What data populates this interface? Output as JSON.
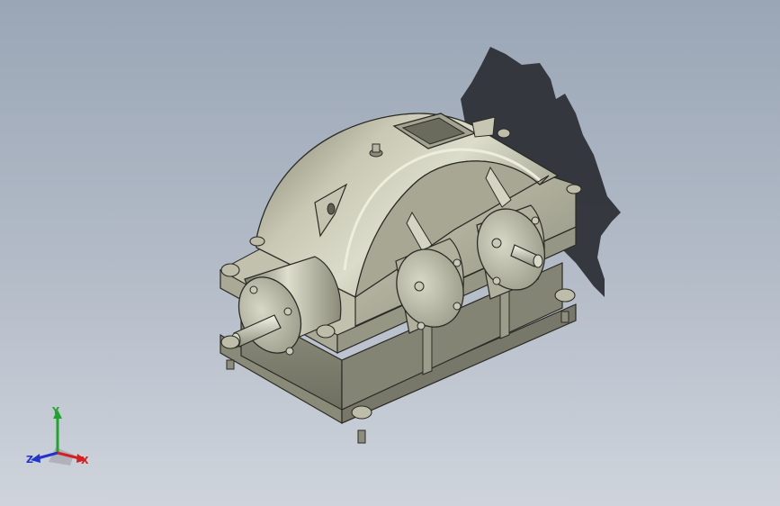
{
  "viewport": {
    "background_top": "#9aa6b6",
    "background_bottom": "#cfd4dc"
  },
  "model": {
    "body_color": "#b5b5a2",
    "shadow_color": "#2a2d33"
  },
  "triad": {
    "x_label": "X",
    "y_label": "Y",
    "z_label": "Z",
    "x_color": "#d42020",
    "y_color": "#1fa52a",
    "z_color": "#2233cc"
  }
}
